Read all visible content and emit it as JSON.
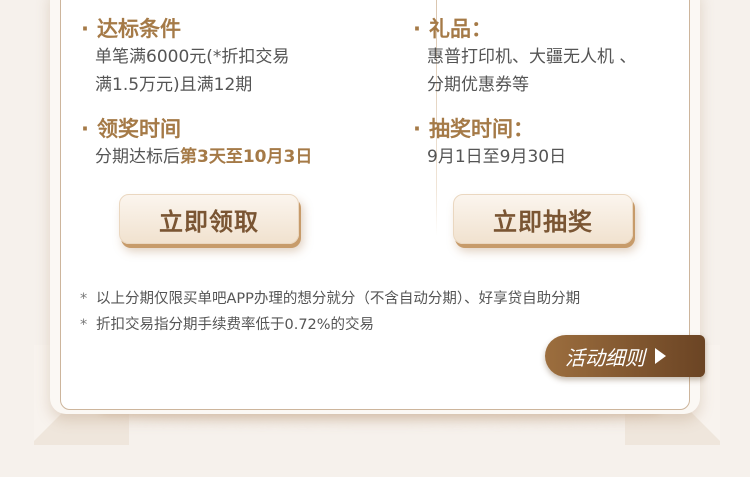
{
  "left": {
    "condition_title": "达标条件",
    "condition_line1": "单笔满6000元(*折扣交易",
    "condition_line2": "满1.5万元)且满12期",
    "claim_title": "领奖时间",
    "claim_prefix": "分期达标后",
    "claim_highlight": "第3天至10月3日",
    "button": "立即领取"
  },
  "right": {
    "gift_title": "礼品：",
    "gift_line1": "惠普打印机、大疆无人机 、",
    "gift_line2": "分期优惠券等",
    "draw_title": "抽奖时间：",
    "draw_text": "9月1日至9月30日",
    "button": "立即抽奖"
  },
  "notes": [
    "以上分期仅限买单吧APP办理的想分就分（不含自动分期）、好享贷自助分期",
    "折扣交易指分期手续费率低于0.72%的交易"
  ],
  "rules_button": "活动细则"
}
